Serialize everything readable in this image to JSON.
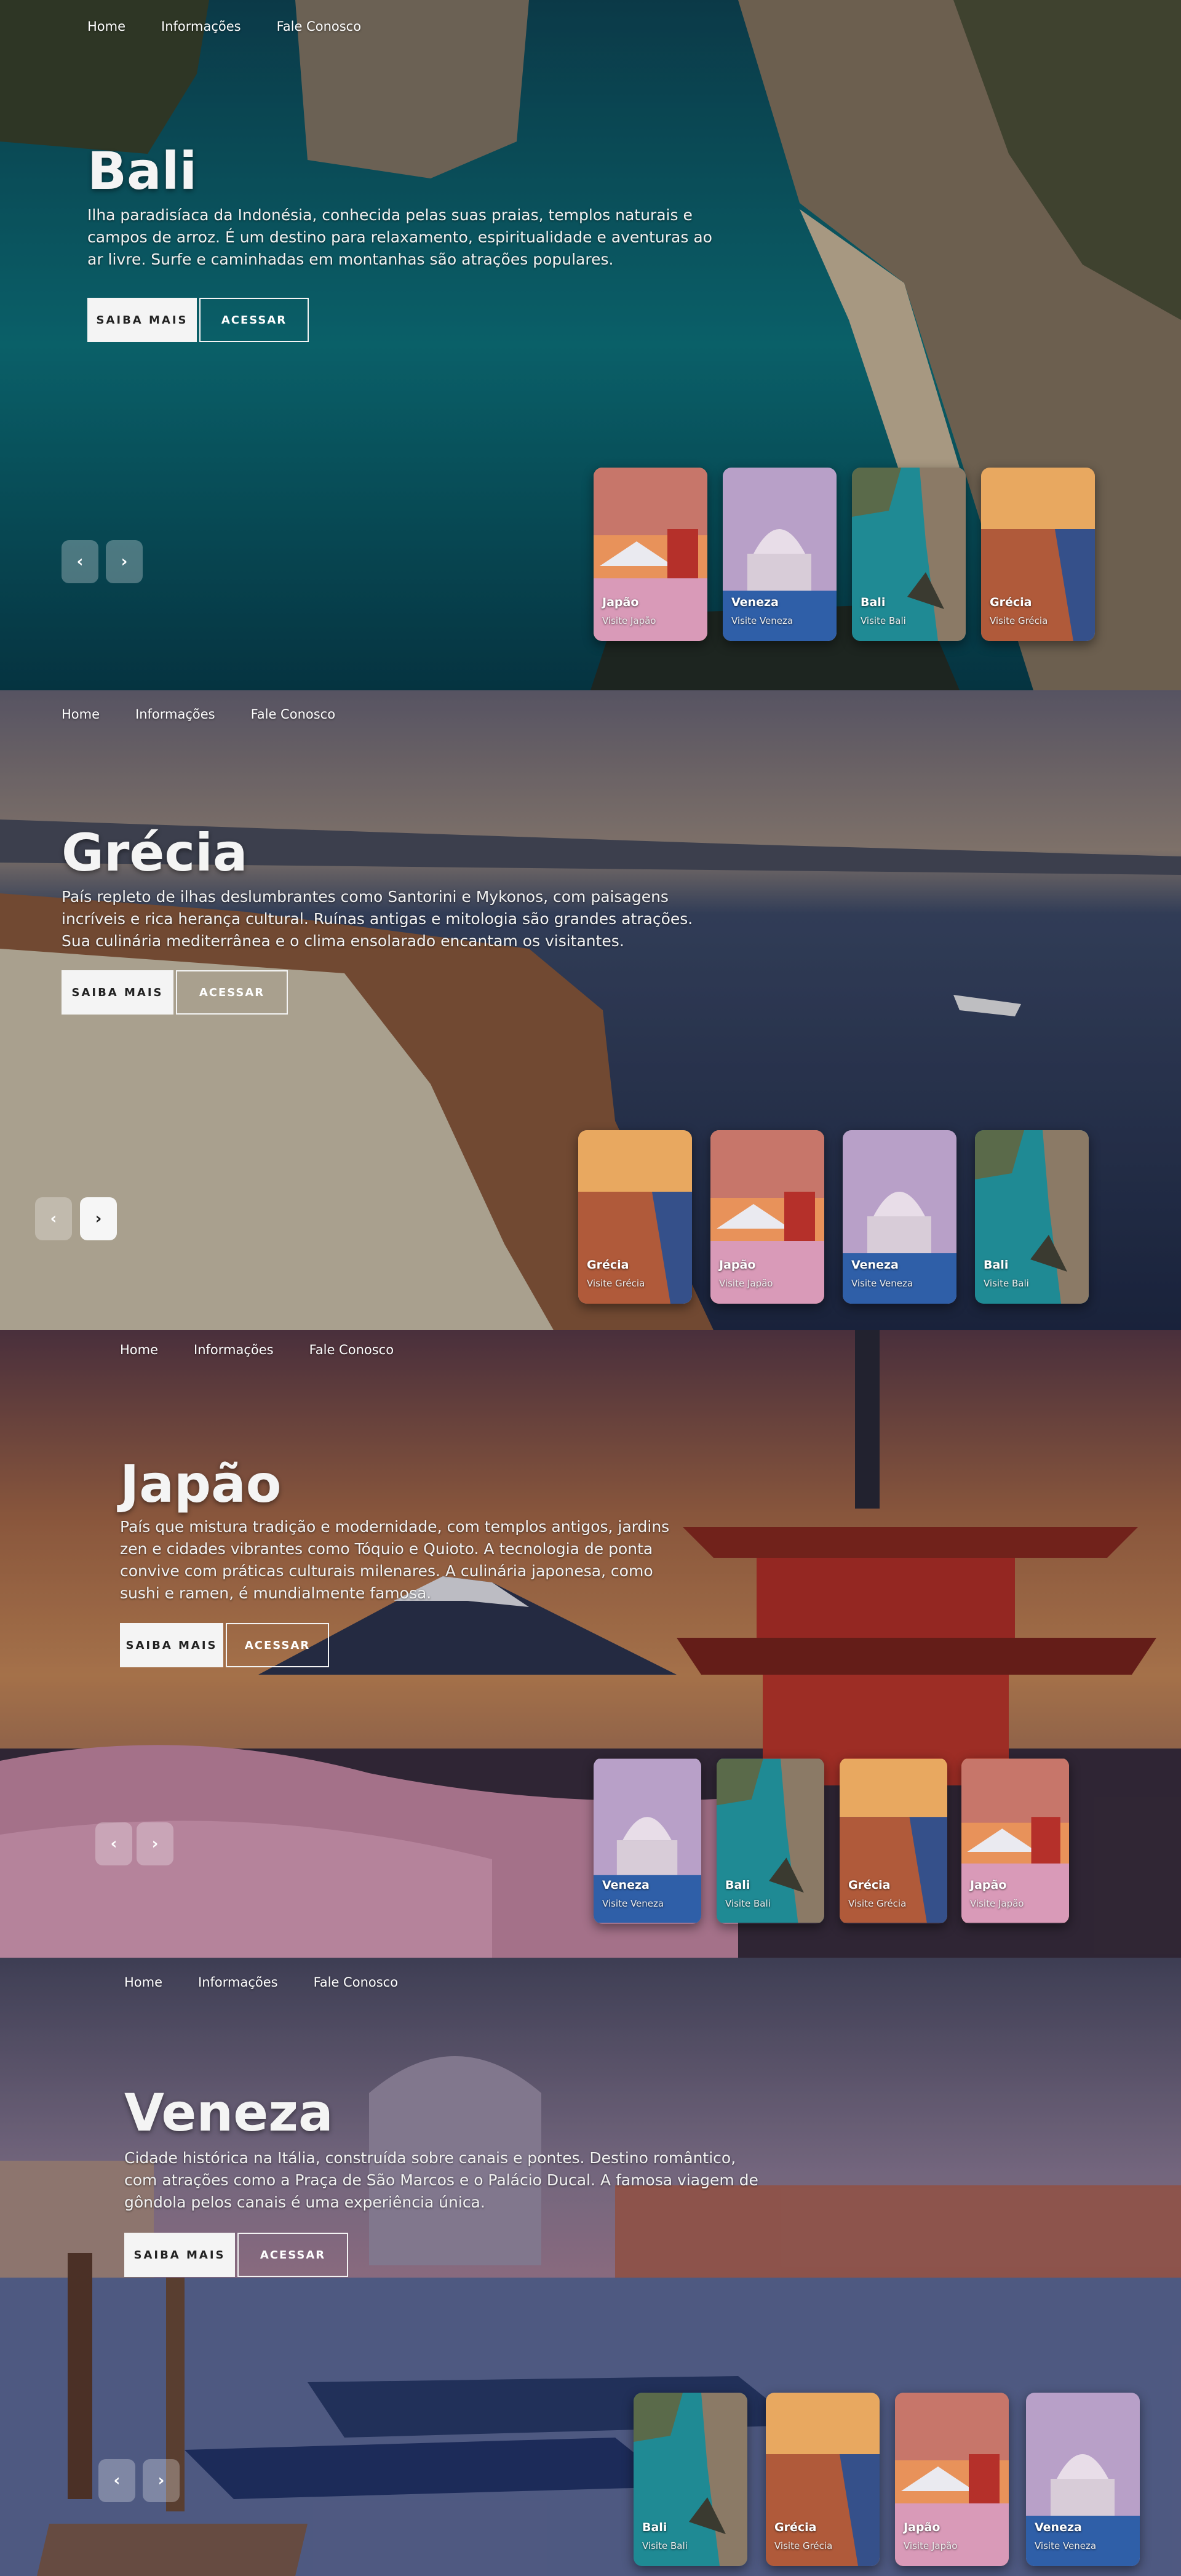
{
  "nav": {
    "home": "Home",
    "info": "Informações",
    "contact": "Fale Conosco"
  },
  "buttons": {
    "more": "SAIBA MAIS",
    "access": "ACESSAR"
  },
  "arrows": {
    "prev": "‹",
    "next": "›"
  },
  "slides": [
    {
      "title": "Bali",
      "description": "Ilha paradisíaca da Indonésia, conhecida pelas suas praias, templos naturais e campos de arroz. É um destino para relaxamento, espiritualidade e aventuras ao ar livre. Surfe e caminhadas em montanhas são atrações populares.",
      "cards": [
        {
          "name": "Japão",
          "sub": "Visite Japão"
        },
        {
          "name": "Veneza",
          "sub": "Visite Veneza"
        },
        {
          "name": "Bali",
          "sub": "Visite Bali"
        },
        {
          "name": "Grécia",
          "sub": "Visite Grécia"
        }
      ]
    },
    {
      "title": "Grécia",
      "description": "País repleto de ilhas deslumbrantes como Santorini e Mykonos, com paisagens incríveis e rica herança cultural. Ruínas antigas e mitologia são grandes atrações. Sua culinária mediterrânea e o clima ensolarado encantam os visitantes.",
      "cards": [
        {
          "name": "Grécia",
          "sub": "Visite Grécia"
        },
        {
          "name": "Japão",
          "sub": "Visite Japão"
        },
        {
          "name": "Veneza",
          "sub": "Visite Veneza"
        },
        {
          "name": "Bali",
          "sub": "Visite Bali"
        }
      ]
    },
    {
      "title": "Japão",
      "description": "País que mistura tradição e modernidade, com templos antigos, jardins zen e cidades vibrantes como Tóquio e Quioto. A tecnologia de ponta convive com práticas culturais milenares. A culinária japonesa, como sushi e ramen, é mundialmente famosa.",
      "cards": [
        {
          "name": "Veneza",
          "sub": "Visite Veneza"
        },
        {
          "name": "Bali",
          "sub": "Visite Bali"
        },
        {
          "name": "Grécia",
          "sub": "Visite Grécia"
        },
        {
          "name": "Japão",
          "sub": "Visite Japão"
        }
      ]
    },
    {
      "title": "Veneza",
      "description": "Cidade histórica na Itália, construída sobre canais e pontes. Destino romântico, com atrações como a Praça de São Marcos e o Palácio Ducal. A famosa viagem de gôndola pelos canais é uma experiência única.",
      "cards": [
        {
          "name": "Bali",
          "sub": "Visite Bali"
        },
        {
          "name": "Grécia",
          "sub": "Visite Grécia"
        },
        {
          "name": "Japão",
          "sub": "Visite Japão"
        },
        {
          "name": "Veneza",
          "sub": "Visite Veneza"
        }
      ]
    }
  ]
}
